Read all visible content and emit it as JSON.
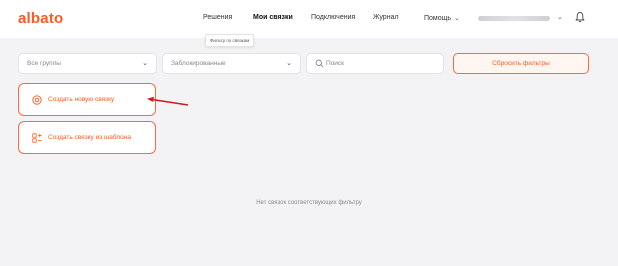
{
  "header": {
    "logo": "albato",
    "nav": [
      {
        "label": "Решения",
        "active": false
      },
      {
        "label": "Мои связки",
        "active": true
      },
      {
        "label": "Подключения",
        "active": false
      },
      {
        "label": "Журнал",
        "active": false
      },
      {
        "label": "Помощь",
        "active": false
      }
    ],
    "help_chevron": "⌄",
    "tooltip": "Фильтр по связкам",
    "user_chevron": "⌄"
  },
  "filters": {
    "groups": {
      "value": "Все группы"
    },
    "status": {
      "value": "Заблокированные"
    },
    "search": {
      "placeholder": "Поиск"
    },
    "reset_label": "Сбросить фильтры"
  },
  "actions": {
    "create_new": "Создать новую связку",
    "create_from_template": "Создать связку из шаблона"
  },
  "empty_message": "Нет связок соответствующих фильтру",
  "colors": {
    "accent": "#ff5a1f",
    "annotation_arrow": "#d11a1a"
  }
}
